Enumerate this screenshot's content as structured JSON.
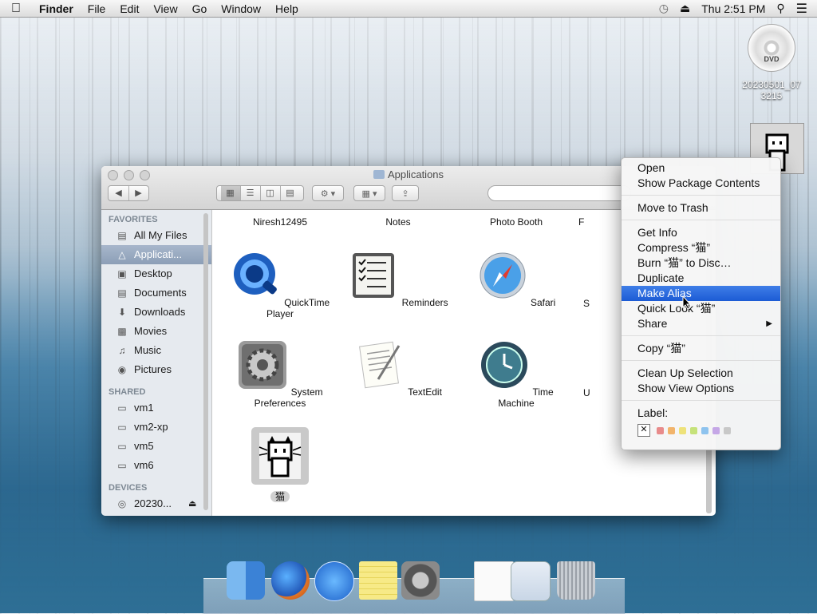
{
  "menubar": {
    "app": "Finder",
    "items": [
      "File",
      "Edit",
      "View",
      "Go",
      "Window",
      "Help"
    ],
    "clock": "Thu 2:51 PM"
  },
  "desktop": {
    "dvd_label_line1": "20230501_07",
    "dvd_label_line2": "3215",
    "dvd_text": "DVD"
  },
  "finder": {
    "title": "Applications",
    "search_placeholder": "",
    "sidebar": {
      "favorites_header": "FAVORITES",
      "favorites": [
        "All My Files",
        "Applicati...",
        "Desktop",
        "Documents",
        "Downloads",
        "Movies",
        "Music",
        "Pictures"
      ],
      "shared_header": "SHARED",
      "shared": [
        "vm1",
        "vm2-xp",
        "vm5",
        "vm6"
      ],
      "devices_header": "DEVICES",
      "devices": [
        "20230..."
      ]
    },
    "row0": [
      "Niresh12495",
      "Notes",
      "Photo Booth",
      "F"
    ],
    "row1": [
      "QuickTime Player",
      "Reminders",
      "Safari",
      "S"
    ],
    "row2": [
      "System Preferences",
      "TextEdit",
      "Time Machine",
      "U"
    ],
    "row3": [
      "猫"
    ]
  },
  "context_menu": {
    "items": [
      "Open",
      "Show Package Contents",
      "Move to Trash",
      "Get Info",
      "Compress “猫”",
      "Burn “猫” to Disc…",
      "Duplicate",
      "Make Alias",
      "Quick Look “猫”",
      "Share",
      "Copy “猫”",
      "Clean Up Selection",
      "Show View Options",
      "Label:"
    ],
    "highlighted": "Make Alias",
    "label_colors": [
      "#e88b8b",
      "#f2b46b",
      "#eee27a",
      "#c6e27a",
      "#8ec3ee",
      "#c5a7e6",
      "#c8c8c8"
    ]
  }
}
